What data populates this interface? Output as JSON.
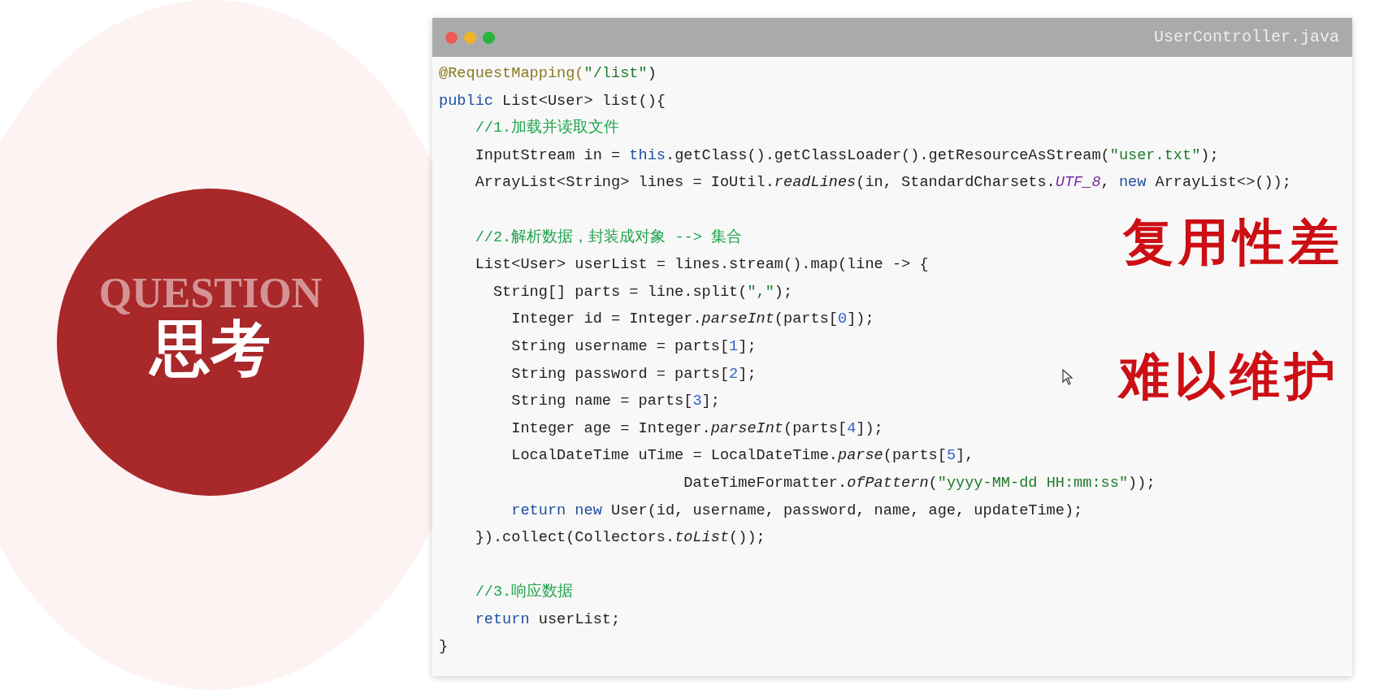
{
  "badge": {
    "background_text": "QUESTION",
    "title": "思考"
  },
  "code_window": {
    "title": "UserController.java",
    "lines": [
      {
        "tokens": [
          {
            "kind": "annotation",
            "text": "@RequestMapping("
          },
          {
            "kind": "string",
            "text": "\"/list\""
          },
          {
            "kind": "plain",
            "text": ")"
          }
        ]
      },
      {
        "tokens": [
          {
            "kind": "keyword",
            "text": "public"
          },
          {
            "kind": "plain",
            "text": " List<User> list(){"
          }
        ]
      },
      {
        "tokens": [
          {
            "kind": "comment",
            "text": "    //1.加载并读取文件"
          }
        ]
      },
      {
        "tokens": [
          {
            "kind": "plain",
            "text": "    InputStream in = "
          },
          {
            "kind": "keyword",
            "text": "this"
          },
          {
            "kind": "plain",
            "text": ".getClass().getClassLoader().getResourceAsStream("
          },
          {
            "kind": "string",
            "text": "\"user.txt\""
          },
          {
            "kind": "plain",
            "text": ");"
          }
        ]
      },
      {
        "tokens": [
          {
            "kind": "plain",
            "text": "    ArrayList<String> lines = IoUtil."
          },
          {
            "kind": "italic",
            "text": "readLines"
          },
          {
            "kind": "plain",
            "text": "(in, StandardCharsets."
          },
          {
            "kind": "const",
            "text": "UTF_8"
          },
          {
            "kind": "plain",
            "text": ", "
          },
          {
            "kind": "keyword",
            "text": "new"
          },
          {
            "kind": "plain",
            "text": " ArrayList<>());"
          }
        ]
      },
      {
        "gap_before": true,
        "tokens": [
          {
            "kind": "comment",
            "text": "    //2.解析数据，封装成对象 --> 集合"
          }
        ]
      },
      {
        "tokens": [
          {
            "kind": "plain",
            "text": "    List<User> userList = lines.stream().map(line -> {"
          }
        ]
      },
      {
        "tokens": [
          {
            "kind": "plain",
            "text": "      String[] parts = line.split("
          },
          {
            "kind": "string",
            "text": "\",\""
          },
          {
            "kind": "plain",
            "text": ");"
          }
        ]
      },
      {
        "tokens": [
          {
            "kind": "plain",
            "text": "        Integer id = Integer."
          },
          {
            "kind": "italic",
            "text": "parseInt"
          },
          {
            "kind": "plain",
            "text": "(parts["
          },
          {
            "kind": "number",
            "text": "0"
          },
          {
            "kind": "plain",
            "text": "]);"
          }
        ]
      },
      {
        "tokens": [
          {
            "kind": "plain",
            "text": "        String username = parts["
          },
          {
            "kind": "number",
            "text": "1"
          },
          {
            "kind": "plain",
            "text": "];"
          }
        ]
      },
      {
        "tokens": [
          {
            "kind": "plain",
            "text": "        String password = parts["
          },
          {
            "kind": "number",
            "text": "2"
          },
          {
            "kind": "plain",
            "text": "];"
          }
        ]
      },
      {
        "tokens": [
          {
            "kind": "plain",
            "text": "        String name = parts["
          },
          {
            "kind": "number",
            "text": "3"
          },
          {
            "kind": "plain",
            "text": "];"
          }
        ]
      },
      {
        "tokens": [
          {
            "kind": "plain",
            "text": "        Integer age = Integer."
          },
          {
            "kind": "italic",
            "text": "parseInt"
          },
          {
            "kind": "plain",
            "text": "(parts["
          },
          {
            "kind": "number",
            "text": "4"
          },
          {
            "kind": "plain",
            "text": "]);"
          }
        ]
      },
      {
        "tokens": [
          {
            "kind": "plain",
            "text": "        LocalDateTime uTime = LocalDateTime."
          },
          {
            "kind": "italic",
            "text": "parse"
          },
          {
            "kind": "plain",
            "text": "(parts["
          },
          {
            "kind": "number",
            "text": "5"
          },
          {
            "kind": "plain",
            "text": "],"
          }
        ]
      },
      {
        "tokens": [
          {
            "kind": "plain",
            "text": "                           DateTimeFormatter."
          },
          {
            "kind": "italic",
            "text": "ofPattern"
          },
          {
            "kind": "plain",
            "text": "("
          },
          {
            "kind": "string",
            "text": "\"yyyy-MM-dd HH:mm:ss\""
          },
          {
            "kind": "plain",
            "text": "));"
          }
        ]
      },
      {
        "tokens": [
          {
            "kind": "keyword",
            "text": "        return new"
          },
          {
            "kind": "plain",
            "text": " User(id, username, password, name, age, updateTime);"
          }
        ]
      },
      {
        "tokens": [
          {
            "kind": "plain",
            "text": "    }).collect(Collectors."
          },
          {
            "kind": "italic",
            "text": "toList"
          },
          {
            "kind": "plain",
            "text": "());"
          }
        ]
      },
      {
        "gap_before": true,
        "tokens": [
          {
            "kind": "comment",
            "text": "    //3.响应数据"
          }
        ]
      },
      {
        "tokens": [
          {
            "kind": "keyword",
            "text": "    return"
          },
          {
            "kind": "plain",
            "text": " userList;"
          }
        ]
      },
      {
        "tokens": [
          {
            "kind": "plain",
            "text": "}"
          }
        ]
      }
    ],
    "stamps": [
      "复用性差",
      "难以维护"
    ]
  }
}
